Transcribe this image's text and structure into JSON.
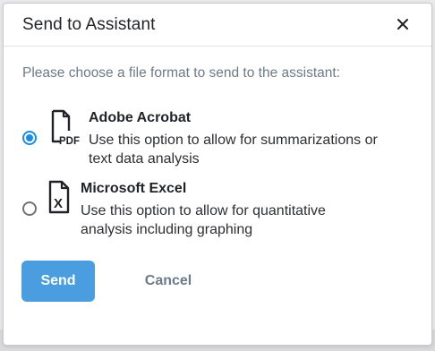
{
  "dialog": {
    "title": "Send to Assistant",
    "close_icon": "close-icon",
    "prompt": "Please choose a file format to send to the assistant:",
    "options": [
      {
        "id": "acrobat",
        "title": "Adobe Acrobat",
        "description_line1": "Use this option to allow for summarizations or",
        "description_line2": "text data analysis",
        "icon": "pdf-file-icon",
        "icon_label": "PDF",
        "selected": true
      },
      {
        "id": "excel",
        "title": "Microsoft Excel",
        "description_line1": "Use this option to allow for quantitative",
        "description_line2": "analysis including graphing",
        "icon": "excel-file-icon",
        "icon_label": "X",
        "selected": false
      }
    ],
    "send_label": "Send",
    "cancel_label": "Cancel"
  },
  "colors": {
    "accent": "#1a8ce8",
    "send_button": "#4a9ee0",
    "muted_text": "#6c7a89"
  }
}
